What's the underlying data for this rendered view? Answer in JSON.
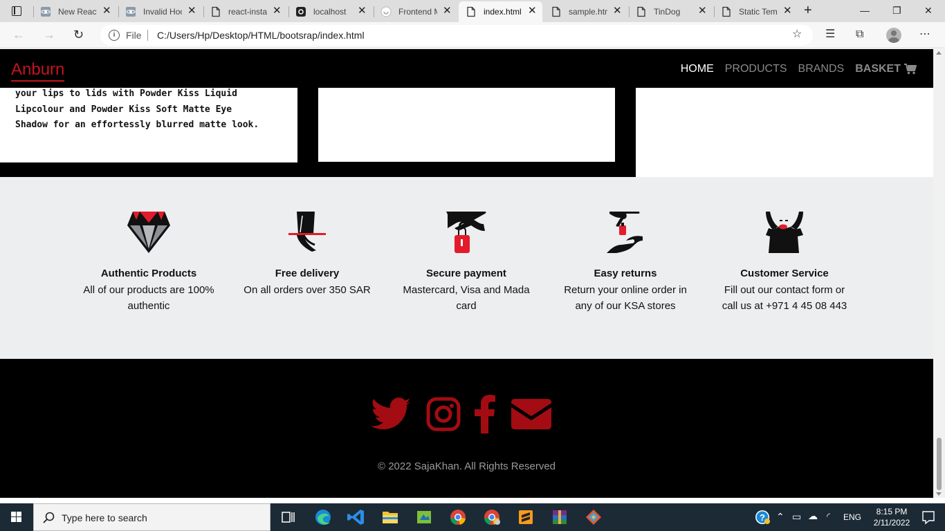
{
  "browser": {
    "tabs": [
      {
        "title": "New React",
        "favicon": "react-icon"
      },
      {
        "title": "Invalid Hook",
        "favicon": "react-icon"
      },
      {
        "title": "react-insta",
        "favicon": "page-icon"
      },
      {
        "title": "localhost",
        "favicon": "localhost-icon"
      },
      {
        "title": "Frontend M",
        "favicon": "frontend-icon"
      },
      {
        "title": "index.html",
        "favicon": "page-icon",
        "active": true
      },
      {
        "title": "sample.html",
        "favicon": "page-icon"
      },
      {
        "title": "TinDog",
        "favicon": "page-icon"
      },
      {
        "title": "Static Temp",
        "favicon": "page-icon"
      }
    ],
    "address": {
      "scheme_label": "File",
      "url": "C:/Users/Hp/Desktop/HTML/bootsrap/index.html"
    }
  },
  "site": {
    "brand": "Anburn",
    "brand_color": "#c3151c",
    "nav": {
      "home": "HOME",
      "products": "PRODUCTS",
      "brands": "BRANDS",
      "basket": "BASKET"
    },
    "card_text": {
      "line1": "your lips to lids with Powder Kiss Liquid",
      "line2": "Lipcolour and Powder Kiss Soft Matte Eye",
      "line3": "Shadow for an effortessly blurred matte look."
    },
    "features": [
      {
        "icon": "diamond-icon",
        "title": "Authentic Products",
        "desc_line1": "All of our products are 100%",
        "desc_line2": "authentic"
      },
      {
        "icon": "delivery-hand-icon",
        "title": "Free delivery",
        "desc_line1": "On all orders over 350 SAR",
        "desc_line2": ""
      },
      {
        "icon": "payment-hand-icon",
        "title": "Secure payment",
        "desc_line1": "Mastercard, Visa and Mada",
        "desc_line2": "card"
      },
      {
        "icon": "returns-hand-icon",
        "title": "Easy returns",
        "desc_line1": "Return your online order in",
        "desc_line2": "any of our KSA stores"
      },
      {
        "icon": "customer-service-icon",
        "title": "Customer Service",
        "desc_line1": "Fill out our contact form or",
        "desc_line2": "call us at +971 4 45 08 443"
      }
    ],
    "footer": {
      "social_icons": [
        "twitter-icon",
        "instagram-icon",
        "facebook-icon",
        "email-icon"
      ],
      "copyright": "© 2022 SajaKhan. All Rights Reserved"
    }
  },
  "taskbar": {
    "search_placeholder": "Type here to search",
    "language": "ENG",
    "time": "8:15 PM",
    "date": "2/11/2022"
  }
}
